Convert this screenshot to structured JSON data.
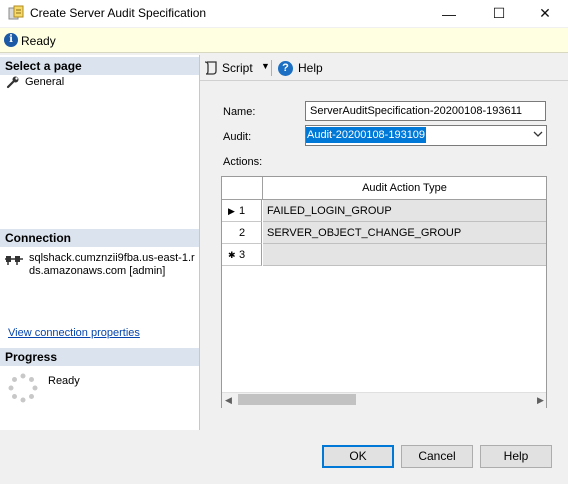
{
  "window": {
    "title": "Create Server Audit Specification",
    "minimize_glyph": "—",
    "maximize_glyph": "☐",
    "close_glyph": "✕"
  },
  "status": {
    "text": "Ready",
    "icon": "info-icon"
  },
  "sidebar": {
    "select_page_header": "Select a page",
    "pages": [
      {
        "label": "General",
        "icon": "wrench-icon"
      }
    ],
    "connection_header": "Connection",
    "connection_text": "sqlshack.cumznzii9fba.us-east-1.rds.amazonaws.com [admin]",
    "view_connection_link": "View connection properties",
    "progress_header": "Progress",
    "progress_status": "Ready"
  },
  "toolbar": {
    "script_label": "Script",
    "help_label": "Help"
  },
  "form": {
    "name_label": "Name:",
    "name_value": "ServerAuditSpecification-20200108-193611",
    "audit_label": "Audit:",
    "audit_value": "Audit-20200108-193109",
    "actions_label": "Actions:"
  },
  "grid": {
    "column_header": "Audit Action Type",
    "rows": [
      {
        "num": "1",
        "marker": "▶",
        "value": "FAILED_LOGIN_GROUP"
      },
      {
        "num": "2",
        "marker": "",
        "value": "SERVER_OBJECT_CHANGE_GROUP"
      },
      {
        "num": "3",
        "marker": "✱",
        "value": ""
      }
    ]
  },
  "buttons": {
    "ok": "OK",
    "cancel": "Cancel",
    "help": "Help"
  },
  "colors": {
    "selection": "#0078d7",
    "status_bg": "#ffffe1",
    "section_header_bg": "#dbe3ee"
  }
}
